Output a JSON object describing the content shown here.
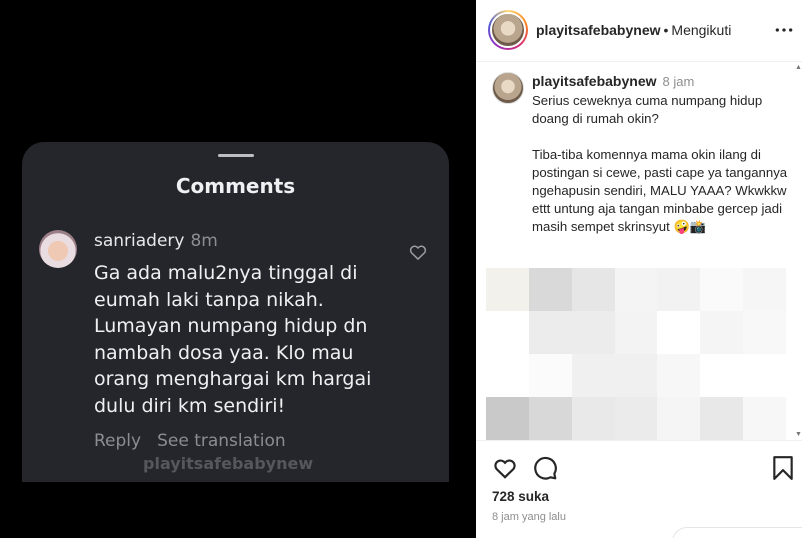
{
  "screenshot": {
    "sheet_title": "Comments",
    "comment": {
      "username": "sanriadery",
      "time": "8m",
      "text": "Ga ada malu2nya tinggal di eumah laki tanpa nikah. Lumayan numpang hidup dn nambah dosa yaa. Klo mau orang menghargai km hargai dulu diri km sendiri!",
      "reply_label": "Reply",
      "translate_label": "See translation"
    },
    "watermark": "playitsafebabynew",
    "icons": {
      "like": "heart-outline-icon"
    }
  },
  "post": {
    "header": {
      "username": "playitsafebabynew",
      "separator": "•",
      "follow_label": "Mengikuti",
      "more_icon": "more-horizontal-icon"
    },
    "caption": {
      "username": "playitsafebabynew",
      "time": "8 jam",
      "text": "Serius ceweknya cuma numpang hidup doang di rumah okin?\n\nTiba-tiba komennya mama okin ilang di postingan si cewe, pasti cape ya tangannya ngehapusin sendiri, MALU YAAA? Wkwkkw ettt untung aja tangan minbabe gercep jadi masih sempet skrinsyut 🤪📸"
    },
    "pixel_colors": [
      "#f3f1ec",
      "#d9d9d9",
      "#e6e6e6",
      "#f4f4f4",
      "#f2f2f2",
      "#fafafa",
      "#f6f6f6",
      "#ffffff",
      "#ececec",
      "#ececec",
      "#f3f3f3",
      "#ffffff",
      "#f5f5f5",
      "#f8f8f8",
      "#ffffff",
      "#fbfbfb",
      "#f0f0f0",
      "#f0f0f0",
      "#f7f7f7",
      "#ffffff",
      "#ffffff",
      "#c9c9c9",
      "#d8d8d8",
      "#e9e9e9",
      "#ebebeb",
      "#f5f5f5",
      "#e8e8e8",
      "#f7f7f7"
    ],
    "actions": {
      "like_icon": "heart-icon",
      "comment_icon": "comment-icon",
      "save_icon": "bookmark-icon"
    },
    "likes": "728 suka",
    "timestamp": "8 jam yang lalu"
  }
}
